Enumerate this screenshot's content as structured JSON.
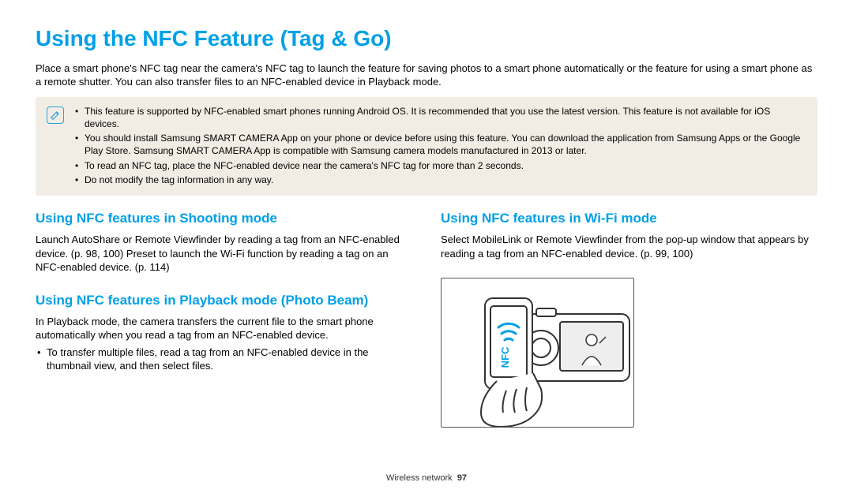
{
  "title": "Using the NFC Feature (Tag & Go)",
  "intro": "Place a smart phone's NFC tag near the camera's NFC tag to launch the feature for saving photos to a smart phone automatically or the feature for using a smart phone as a remote shutter. You can also transfer files to an NFC-enabled device in Playback mode.",
  "note": {
    "icon_name": "note-icon",
    "items": [
      "This feature is supported by NFC-enabled smart phones running Android OS. It is recommended that you use the latest version. This feature is not available for iOS devices.",
      "You should install Samsung SMART CAMERA App on your phone or device before using this feature. You can download the application from Samsung Apps or the Google Play Store. Samsung SMART CAMERA App is compatible with Samsung camera models manufactured in 2013 or later.",
      "To read an NFC tag, place the NFC-enabled device near the camera's NFC tag for more than 2 seconds.",
      "Do not modify the tag information in any way."
    ]
  },
  "left": {
    "shooting": {
      "heading": "Using NFC features in Shooting mode",
      "body": "Launch AutoShare or Remote Viewfinder by reading a tag from an NFC-enabled device. (p. 98, 100) Preset to launch the Wi-Fi function by reading a tag on an NFC-enabled device. (p. 114)"
    },
    "playback": {
      "heading": "Using NFC features in Playback mode (Photo Beam)",
      "body": "In Playback mode, the camera transfers the current file to the smart phone automatically when you read a tag from an NFC-enabled device.",
      "bullet": "To transfer multiple files, read a tag from an NFC-enabled device in the thumbnail view, and then select files."
    }
  },
  "right": {
    "wifi": {
      "heading": "Using NFC features in Wi-Fi mode",
      "body": "Select MobileLink or Remote Viewfinder from the pop-up window that appears by reading a tag from an NFC-enabled device. (p. 99, 100)"
    },
    "nfc_label": "NFC"
  },
  "footer": {
    "section": "Wireless network",
    "page": "97"
  },
  "colors": {
    "accent": "#00a0e6",
    "note_bg": "#f1ece4"
  }
}
